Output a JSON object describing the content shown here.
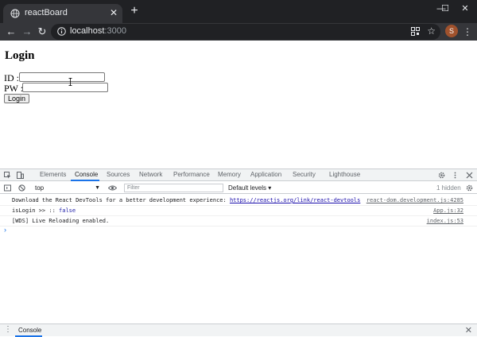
{
  "browser": {
    "tab_title": "reactBoard",
    "tab_close": "✕",
    "new_tab": "+",
    "window_controls": {
      "minimize": "—",
      "maximize": "☐",
      "close": "✕"
    },
    "nav": {
      "back": "←",
      "forward": "→",
      "reload": "↻"
    },
    "url_host": "localhost",
    "url_port": ":3000",
    "profile_initial": "S",
    "menu": "⋮",
    "star": "☆"
  },
  "page": {
    "heading": "Login",
    "id_label": "ID :",
    "pw_label": "PW :",
    "login_button": "Login",
    "id_value": "",
    "pw_value": ""
  },
  "devtools": {
    "tabs": [
      "Elements",
      "Console",
      "Sources",
      "Network",
      "Performance",
      "Memory",
      "Application",
      "Security",
      "Lighthouse"
    ],
    "active_tab": "Console",
    "context": "top",
    "filter_placeholder": "Filter",
    "levels": "Default levels ▾",
    "hidden": "1 hidden",
    "messages": [
      {
        "text": "Download the React DevTools for a better development experience: ",
        "link": "https://reactjs.org/link/react-devtools",
        "source": "react-dom.development.js:4285"
      },
      {
        "text": "isLogin >> ::  ",
        "value": "false",
        "source": "App.js:32"
      },
      {
        "text": "[WDS] Live Reloading enabled.",
        "source": "index.js:53"
      }
    ],
    "prompt": "›",
    "drawer_tab": "Console",
    "drawer_close": "✕"
  },
  "colors": {
    "titlebar": "#202124",
    "toolbar": "#35363a",
    "accent": "#1a73e8"
  }
}
